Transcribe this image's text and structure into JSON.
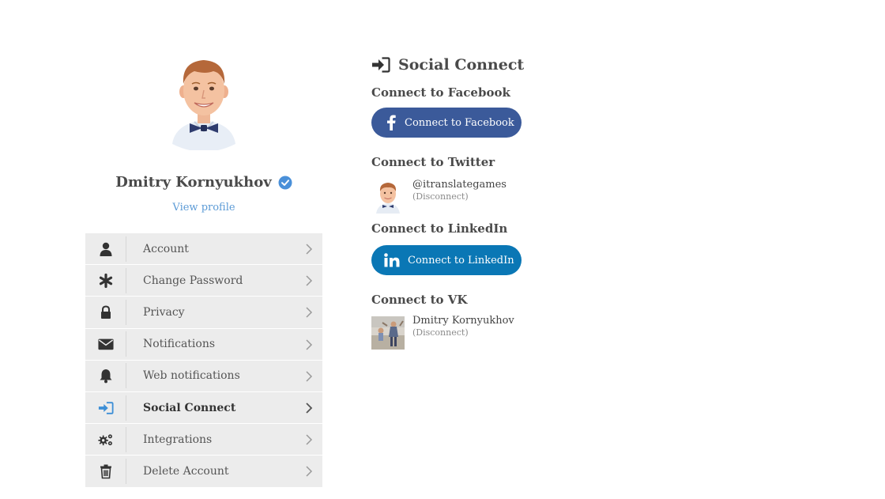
{
  "profile": {
    "name": "Dmitry Kornyukhov",
    "view_profile": "View profile"
  },
  "menu": {
    "items": [
      {
        "label": "Account",
        "icon": "user-icon"
      },
      {
        "label": "Change Password",
        "icon": "asterisk-icon"
      },
      {
        "label": "Privacy",
        "icon": "lock-icon"
      },
      {
        "label": "Notifications",
        "icon": "envelope-icon"
      },
      {
        "label": "Web notifications",
        "icon": "bell-icon"
      },
      {
        "label": "Social Connect",
        "icon": "sign-in-icon",
        "active": true
      },
      {
        "label": "Integrations",
        "icon": "gears-icon"
      },
      {
        "label": "Delete Account",
        "icon": "trash-icon"
      }
    ]
  },
  "social": {
    "title": "Social Connect",
    "facebook": {
      "heading": "Connect to Facebook",
      "button": "Connect to Facebook"
    },
    "twitter": {
      "heading": "Connect to Twitter",
      "account": "@itranslategames",
      "disconnect": "(Disconnect)"
    },
    "linkedin": {
      "heading": "Connect to LinkedIn",
      "button": "Connect to LinkedIn"
    },
    "vk": {
      "heading": "Connect to VK",
      "account": "Dmitry Kornyukhov",
      "disconnect": "(Disconnect)"
    }
  },
  "colors": {
    "facebook": "#3b5a9a",
    "linkedin": "#0a77b5",
    "link": "#5c9bd6",
    "active_icon": "#3d8fd6",
    "menu_bg": "#ececec"
  }
}
